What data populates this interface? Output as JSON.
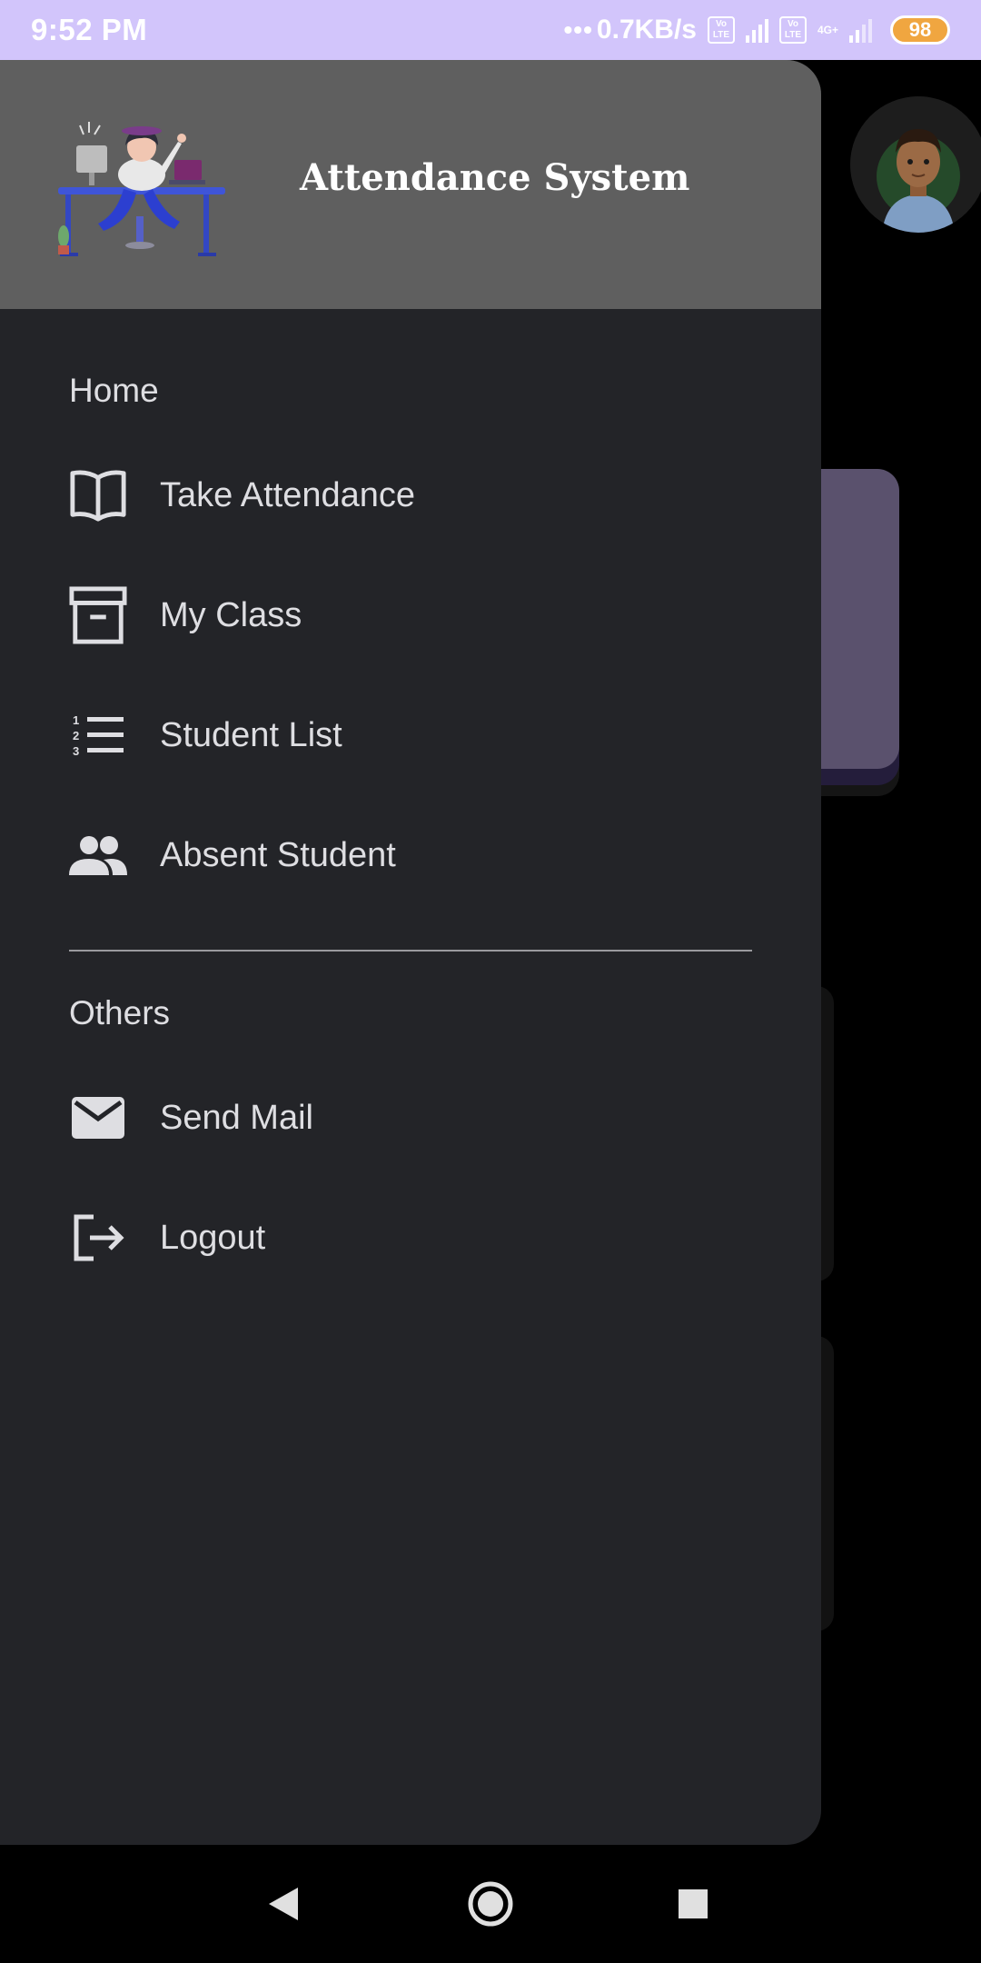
{
  "status_bar": {
    "time": "9:52 PM",
    "net_speed": "0.7KB/s",
    "sim1_badge": "Vo LTE",
    "sim2_badge": "Vo LTE",
    "sim2_net_type": "4G+",
    "battery_level": "98"
  },
  "drawer": {
    "header": {
      "title": "Attendance System",
      "illustration": "student-at-desk-illustration"
    },
    "sections": [
      {
        "label": "Home",
        "items": [
          {
            "label": "Take Attendance",
            "icon": "book-open-icon"
          },
          {
            "label": "My Class",
            "icon": "archive-box-icon"
          },
          {
            "label": "Student List",
            "icon": "numbered-list-icon"
          },
          {
            "label": "Absent Student",
            "icon": "group-people-icon"
          }
        ]
      },
      {
        "label": "Others",
        "items": [
          {
            "label": "Send Mail",
            "icon": "mail-icon"
          },
          {
            "label": "Logout",
            "icon": "logout-icon"
          }
        ]
      }
    ]
  },
  "background_screen": {
    "avatar": "user-avatar"
  },
  "nav_bar": {
    "back": "back-triangle-icon",
    "home": "home-circle-icon",
    "recents": "recents-square-icon"
  },
  "colors": {
    "status_bar_bg": "#d2c5fb",
    "drawer_bg": "#232428",
    "drawer_header_bg": "#5f5f5f",
    "menu_text": "#dedee2",
    "battery": "#f0a640"
  }
}
